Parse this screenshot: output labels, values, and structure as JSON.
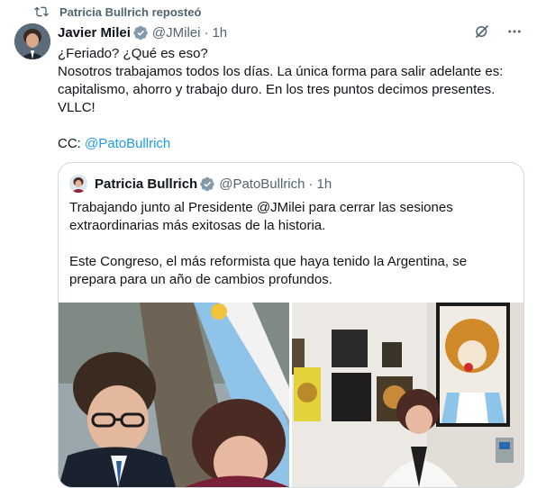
{
  "repost": {
    "label": "Patricia Bullrich reposteó"
  },
  "tweet": {
    "author_name": "Javier Milei",
    "handle": "@JMilei",
    "separator": "·",
    "time": "1h",
    "text": "¿Feriado? ¿Qué es eso?\nNosotros trabajamos todos los días. La única forma para salir adelante es: capitalismo, ahorro y trabajo duro. En los tres puntos decimos presentes. VLLC!\n\nCC: ",
    "mention": "@PatoBullrich"
  },
  "quote": {
    "author_name": "Patricia Bullrich",
    "handle": "@PatoBullrich",
    "separator": "·",
    "time": "1h",
    "text": "Trabajando junto al Presidente @JMilei para cerrar las sesiones extraordinarias más exitosas de la historia.\n\nEste Congreso, el más reformista que haya tenido la Argentina, se prepara para un año de cambios profundos."
  },
  "colors": {
    "accent": "#1d9bf0",
    "text": "#0f1419",
    "muted": "#536471",
    "border": "#cfd9de"
  },
  "icons": [
    "repost-icon",
    "verified-badge-icon",
    "grok-icon",
    "more-icon"
  ]
}
